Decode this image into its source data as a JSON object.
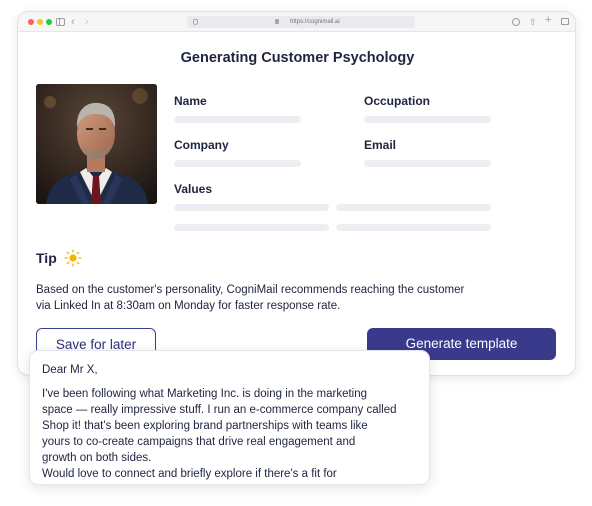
{
  "browser": {
    "url": "https://cognimail.ai"
  },
  "page": {
    "title": "Generating Customer Psychology"
  },
  "profile": {
    "fields": {
      "name_label": "Name",
      "occupation_label": "Occupation",
      "company_label": "Company",
      "email_label": "Email",
      "values_label": "Values"
    }
  },
  "tip": {
    "label": "Tip",
    "icon": "sun-icon",
    "text_line1": "Based on the customer's personality, CogniMail recommends reaching the customer",
    "text_line2": "via Linked In at 8:30am on Monday for faster response rate."
  },
  "actions": {
    "save_label": "Save for later",
    "generate_label": "Generate template"
  },
  "email_draft": {
    "greeting": "Dear Mr X,",
    "line1": "I've been following what Marketing Inc. is  doing in the marketing",
    "line2": "space — really impressive stuff. I run an e-commerce company called",
    "line3": "Shop it! that's been exploring brand partnerships with teams like",
    "line4": "yours to co-create campaigns that drive real engagement and",
    "line5": "growth on both sides.",
    "line6": "Would love to connect and briefly explore if there's a fit for"
  },
  "colors": {
    "primary": "#3a3a8c",
    "text": "#1f2440",
    "skeleton": "#eceef1",
    "sun": "#f5b400"
  }
}
